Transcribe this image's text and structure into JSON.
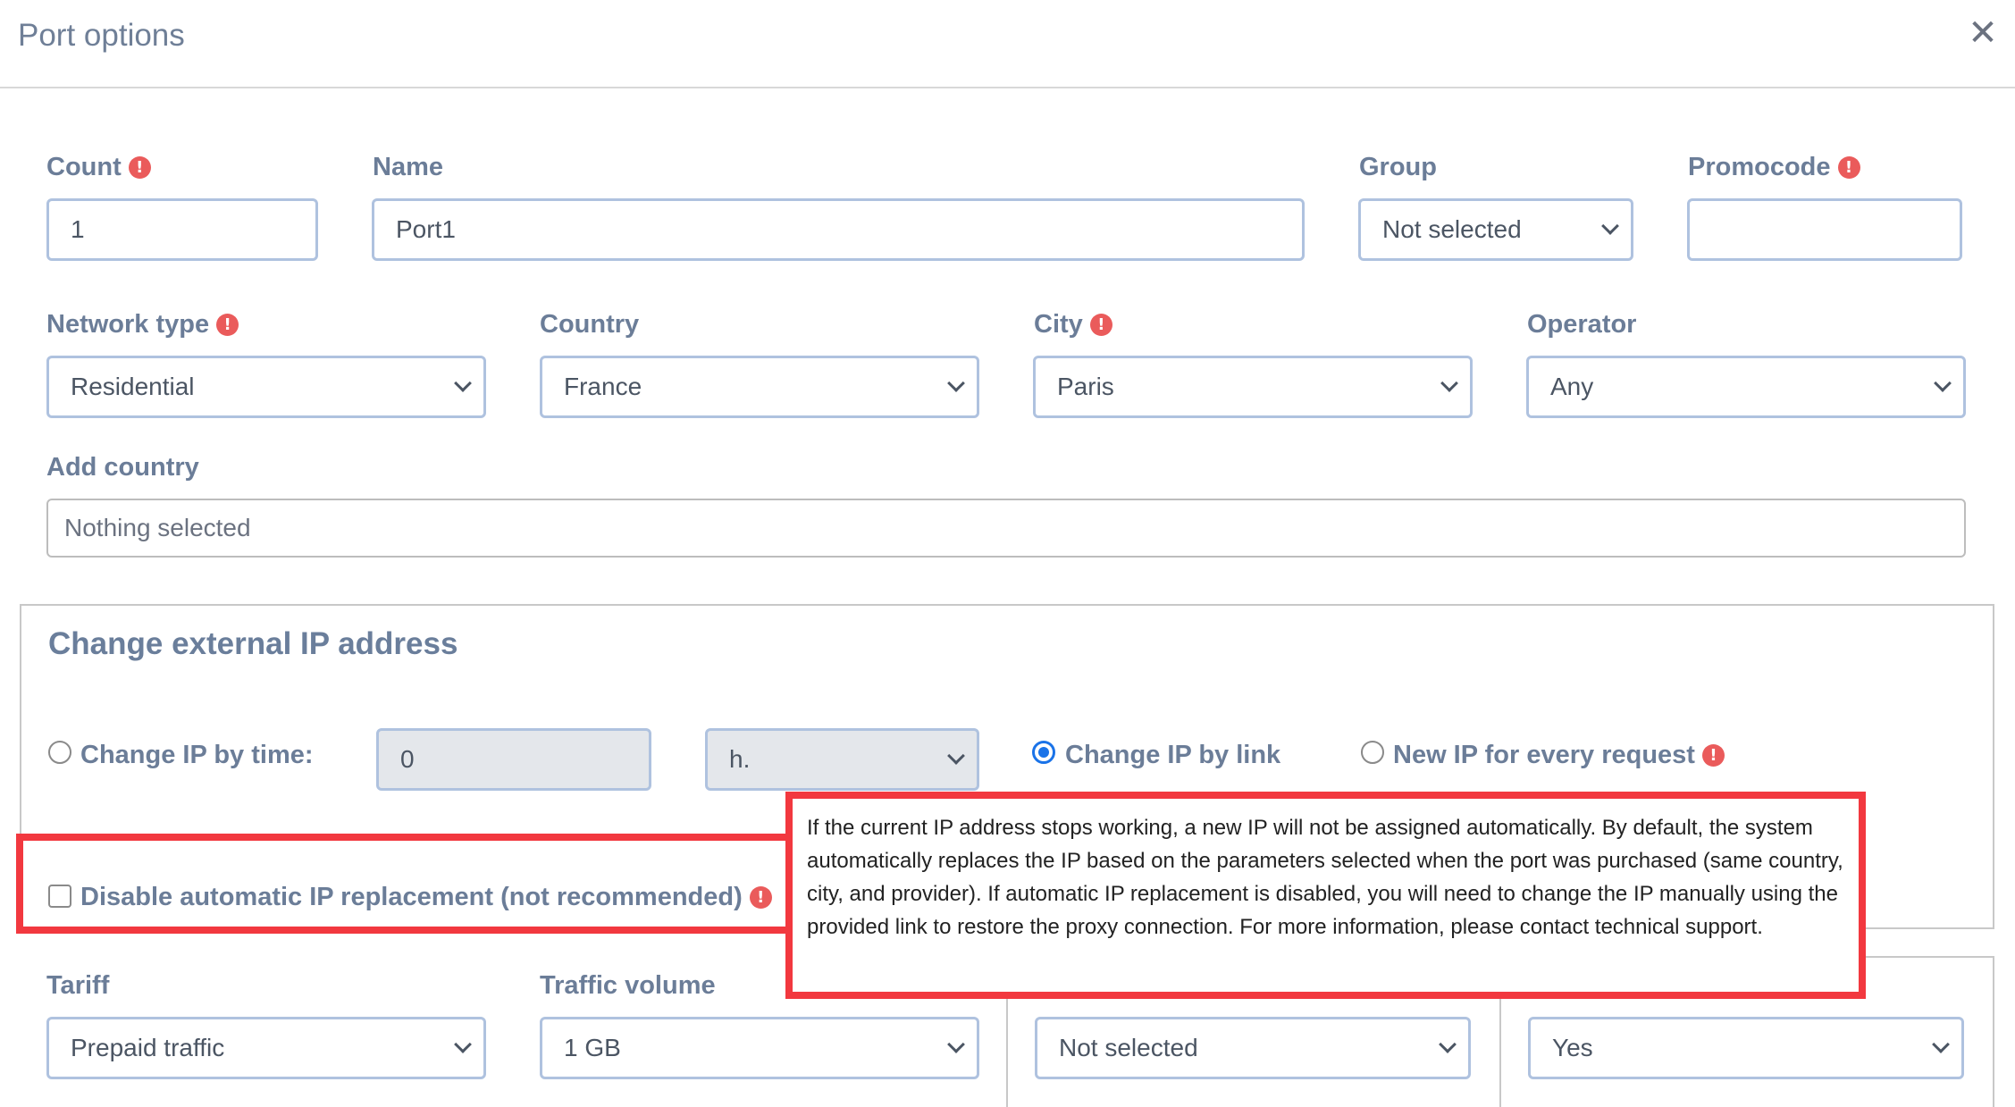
{
  "window": {
    "title": "Port options"
  },
  "row1": {
    "count": {
      "label": "Count",
      "value": "1"
    },
    "name": {
      "label": "Name",
      "value": "Port1"
    },
    "group": {
      "label": "Group",
      "value": "Not selected"
    },
    "promocode": {
      "label": "Promocode",
      "value": ""
    }
  },
  "row2": {
    "network_type": {
      "label": "Network type",
      "value": "Residential"
    },
    "country": {
      "label": "Country",
      "value": "France"
    },
    "city": {
      "label": "City",
      "value": "Paris"
    },
    "operator": {
      "label": "Operator",
      "value": "Any"
    }
  },
  "add_country": {
    "label": "Add country",
    "placeholder": "Nothing selected"
  },
  "change_ip": {
    "title": "Change external IP address",
    "by_time": {
      "label": "Change IP by time:",
      "value": "0",
      "unit": "h.",
      "selected": false
    },
    "by_link": {
      "label": "Change IP by link",
      "selected": true
    },
    "every_request": {
      "label": "New IP for every request",
      "selected": false
    },
    "disable_auto": {
      "label": "Disable automatic IP replacement (not recommended)",
      "checked": false
    },
    "tooltip": "If the current IP address stops working, a new IP will not be assigned automatically. By default, the system automatically replaces the IP based on the parameters selected when the port was purchased (same country, city, and provider). If automatic IP replacement is disabled, you will need to change the IP manually using the provided link to restore the proxy connection. For more information, please contact technical support."
  },
  "row3": {
    "tariff": {
      "label": "Tariff",
      "value": "Prepaid traffic"
    },
    "traffic_volume": {
      "label": "Traffic volume",
      "value": "1 GB"
    },
    "third": {
      "value": "Not selected"
    },
    "fourth": {
      "value": "Yes"
    }
  },
  "icons": {
    "close": "close-icon",
    "required": "exclamation-icon",
    "dropdown": "chevron-down-icon"
  },
  "colors": {
    "accent": "#1a73e8",
    "required": "#ea5b5b",
    "highlight": "#f2383f",
    "label": "#6b7d98",
    "border": "#afc2df"
  }
}
